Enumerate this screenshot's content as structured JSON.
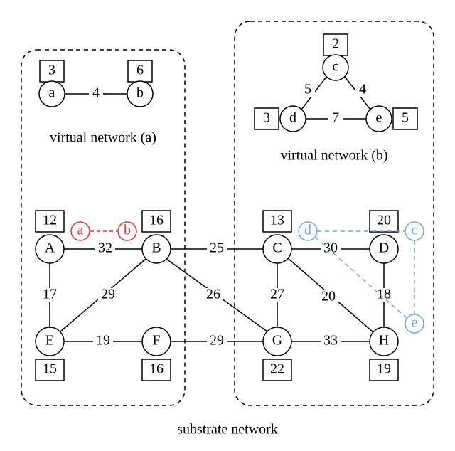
{
  "captions": {
    "vn_a": "virtual network (a)",
    "vn_b": "virtual network (b)",
    "substrate": "substrate network"
  },
  "virtual_a": {
    "nodes": {
      "a": {
        "label": "a",
        "box": "3"
      },
      "b": {
        "label": "b",
        "box": "6"
      }
    },
    "edges": {
      "ab": {
        "w": "4"
      }
    }
  },
  "virtual_b": {
    "nodes": {
      "c": {
        "label": "c",
        "box": "2"
      },
      "d": {
        "label": "d",
        "box": "3"
      },
      "e": {
        "label": "e",
        "box": "5"
      }
    },
    "edges": {
      "cd": {
        "w": "5"
      },
      "ce": {
        "w": "4"
      },
      "de": {
        "w": "7"
      }
    }
  },
  "substrate": {
    "nodes": {
      "A": {
        "label": "A",
        "box": "12"
      },
      "B": {
        "label": "B",
        "box": "16"
      },
      "C": {
        "label": "C",
        "box": "13"
      },
      "D": {
        "label": "D",
        "box": "20"
      },
      "E": {
        "label": "E",
        "box": "15"
      },
      "F": {
        "label": "F",
        "box": "16"
      },
      "G": {
        "label": "G",
        "box": "22"
      },
      "H": {
        "label": "H",
        "box": "19"
      }
    },
    "edges": {
      "AB": {
        "w": "32"
      },
      "BC": {
        "w": "25"
      },
      "CD": {
        "w": "30"
      },
      "AE": {
        "w": "17"
      },
      "BE": {
        "w": "29"
      },
      "BG": {
        "w": "26"
      },
      "CG": {
        "w": "27"
      },
      "CH": {
        "w": "20"
      },
      "DH": {
        "w": "18"
      },
      "EF": {
        "w": "19"
      },
      "FG": {
        "w": "29"
      },
      "GH": {
        "w": "33"
      }
    },
    "mapping_a": {
      "a": {
        "label": "a"
      },
      "b": {
        "label": "b"
      }
    },
    "mapping_b": {
      "c": {
        "label": "c"
      },
      "d": {
        "label": "d"
      },
      "e": {
        "label": "e"
      }
    }
  }
}
